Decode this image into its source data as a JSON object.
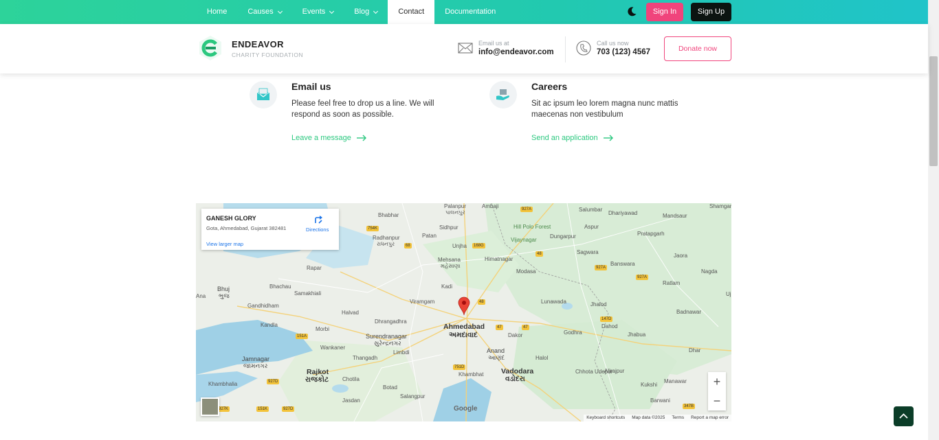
{
  "nav": {
    "items": [
      {
        "label": "Home",
        "dropdown": false,
        "active": false
      },
      {
        "label": "Causes",
        "dropdown": true,
        "active": false
      },
      {
        "label": "Events",
        "dropdown": true,
        "active": false
      },
      {
        "label": "Blog",
        "dropdown": true,
        "active": false
      },
      {
        "label": "Contact",
        "dropdown": false,
        "active": true
      },
      {
        "label": "Documentation",
        "dropdown": false,
        "active": false
      }
    ],
    "signin_label": "Sign In",
    "signup_label": "Sign Up",
    "theme_icon": "moon-icon"
  },
  "header": {
    "brand_name": "ENDEAVOR",
    "brand_tagline": "CHARITY FOUNDATION",
    "email_label": "Email us at",
    "email_value": "info@endeavor.com",
    "call_label": "Call us now",
    "call_value": "703 (123) 4567",
    "donate_label": "Donate now"
  },
  "cards": [
    {
      "icon": "mail-icon",
      "title": "Email us",
      "text": "Please feel free to drop us a line. We will respond as soon as possible.",
      "link": "Leave a message"
    },
    {
      "icon": "careers-icon",
      "title": "Careers",
      "text": "Sit ac ipsum leo lorem magna nunc mattis maecenas non vestibulum",
      "link": "Send an application"
    }
  ],
  "map": {
    "place_name": "GANESH GLORY",
    "place_address": "Gota, Ahmedabad, Gujarat 382481",
    "directions_label": "Directions",
    "larger_map_label": "View larger map",
    "google_label": "Google",
    "attribution": [
      "Keyboard shortcuts",
      "Map data ©2025",
      "Terms",
      "Report a map error"
    ],
    "zoom_in": "+",
    "zoom_out": "−",
    "city_labels": [
      {
        "text": "Ahmedabad",
        "size": "big"
      },
      {
        "text": "અમદાવાદ",
        "size": "big"
      },
      {
        "text": "Vadodara",
        "size": "big"
      },
      {
        "text": "વડોદરા",
        "size": "big"
      },
      {
        "text": "Rajkot",
        "size": "big"
      },
      {
        "text": "રાજકોટ",
        "size": "big"
      },
      {
        "text": "Jamnagar",
        "size": "med"
      },
      {
        "text": "જામનગર",
        "size": "med"
      },
      {
        "text": "Surendranagar",
        "size": "med"
      },
      {
        "text": "સુરેન્દ્રનગર",
        "size": "med"
      },
      {
        "text": "Bhuj",
        "size": "med"
      },
      {
        "text": "ભુજ",
        "size": "med"
      },
      {
        "text": "Anand",
        "size": "med"
      },
      {
        "text": "આણંદ",
        "size": "med"
      },
      {
        "text": "Palanpur",
        "size": "sm"
      },
      {
        "text": "પાલનપુર",
        "size": "sm"
      },
      {
        "text": "Radhanpur",
        "size": "sm"
      },
      {
        "text": "રાધનપુર",
        "size": "sm"
      },
      {
        "text": "Mehsana",
        "size": "sm"
      },
      {
        "text": "મહેસાણા",
        "size": "sm"
      },
      {
        "text": "Himatnagar",
        "size": "sm"
      },
      {
        "text": "Modasa",
        "size": "sm"
      },
      {
        "text": "Kadi",
        "size": "sm"
      },
      {
        "text": "Viramgam",
        "size": "sm"
      },
      {
        "text": "Dhrangadhra",
        "size": "sm"
      },
      {
        "text": "Halvad",
        "size": "sm"
      },
      {
        "text": "Morbi",
        "size": "sm"
      },
      {
        "text": "Wankaner",
        "size": "sm"
      },
      {
        "text": "Gandhidham",
        "size": "sm"
      },
      {
        "text": "Kandla",
        "size": "sm"
      },
      {
        "text": "Bhachau",
        "size": "sm"
      },
      {
        "text": "Samakhiali",
        "size": "sm"
      },
      {
        "text": "Rapar",
        "size": "sm"
      },
      {
        "text": "Bhabhar",
        "size": "sm"
      },
      {
        "text": "Patan",
        "size": "sm"
      },
      {
        "text": "Sidhpur",
        "size": "sm"
      },
      {
        "text": "Unjha",
        "size": "sm"
      },
      {
        "text": "Ambaji",
        "size": "sm"
      },
      {
        "text": "Hill Polo Forest",
        "size": "sm"
      },
      {
        "text": "Vijaynagar",
        "size": "sm"
      },
      {
        "text": "Dungarpur",
        "size": "sm"
      },
      {
        "text": "Salumbar",
        "size": "sm"
      },
      {
        "text": "Aspur",
        "size": "sm"
      },
      {
        "text": "Dhariyawad",
        "size": "sm"
      },
      {
        "text": "Mandsaur",
        "size": "sm"
      },
      {
        "text": "Shamgarh",
        "size": "sm"
      },
      {
        "text": "Pratapgarh",
        "size": "sm"
      },
      {
        "text": "Sagwara",
        "size": "sm"
      },
      {
        "text": "Banswara",
        "size": "sm"
      },
      {
        "text": "Jaora",
        "size": "sm"
      },
      {
        "text": "Nagda",
        "size": "sm"
      },
      {
        "text": "Ratlam",
        "size": "sm"
      },
      {
        "text": "Lunawada",
        "size": "sm"
      },
      {
        "text": "Jhalod",
        "size": "sm"
      },
      {
        "text": "Dahod",
        "size": "sm"
      },
      {
        "text": "Jhabua",
        "size": "sm"
      },
      {
        "text": "Badnawar",
        "size": "sm"
      },
      {
        "text": "Godhra",
        "size": "sm"
      },
      {
        "text": "Dakor",
        "size": "sm"
      },
      {
        "text": "Halol",
        "size": "sm"
      },
      {
        "text": "Chhota Udepur",
        "size": "sm"
      },
      {
        "text": "Alirajpur",
        "size": "sm"
      },
      {
        "text": "Kukshi",
        "size": "sm"
      },
      {
        "text": "Manawar",
        "size": "sm"
      },
      {
        "text": "Barwani",
        "size": "sm"
      },
      {
        "text": "Dhar",
        "size": "sm"
      },
      {
        "text": "Khambhat",
        "size": "sm"
      },
      {
        "text": "Limbdi",
        "size": "sm"
      },
      {
        "text": "Thangadh",
        "size": "sm"
      },
      {
        "text": "Chotila",
        "size": "sm"
      },
      {
        "text": "Botad",
        "size": "sm"
      },
      {
        "text": "Jasdan",
        "size": "sm"
      },
      {
        "text": "Salangpur",
        "size": "sm"
      },
      {
        "text": "Khambhalia",
        "size": "sm"
      },
      {
        "text": "Ana",
        "size": "sm"
      },
      {
        "text": "Uj",
        "size": "sm"
      }
    ]
  },
  "scroll_top_icon": "chevron-up-icon"
}
